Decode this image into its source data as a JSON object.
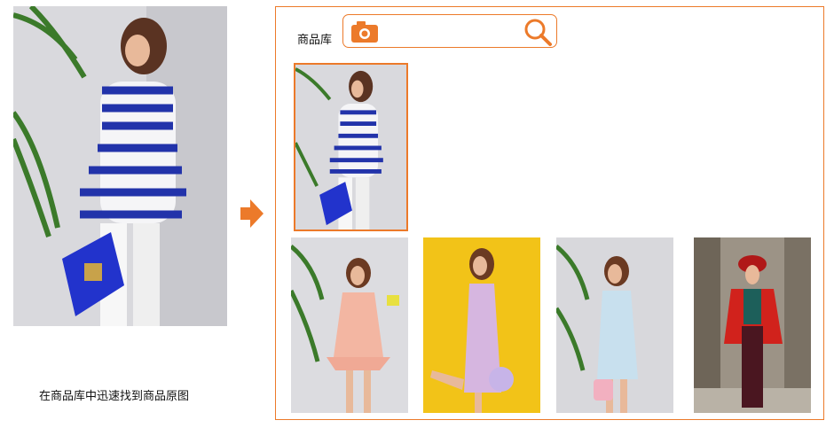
{
  "left": {
    "caption": "在商品库中迅速找到商品原图",
    "photo_icon": "woman-blue-striped-top-photo"
  },
  "arrow_icon": "arrow-right-icon",
  "library": {
    "label": "商品库",
    "search_placeholder": "",
    "camera_icon": "camera-icon",
    "search_icon": "search-icon"
  },
  "colors": {
    "accent": "#ec7a2a",
    "border": "#ec7a2a"
  },
  "results": {
    "selected": "woman-blue-striped-top-photo",
    "others": [
      "woman-pink-dress-photo",
      "woman-lavender-dress-yellow-background-photo",
      "woman-light-blue-dress-photo",
      "woman-red-coat-photo"
    ]
  }
}
